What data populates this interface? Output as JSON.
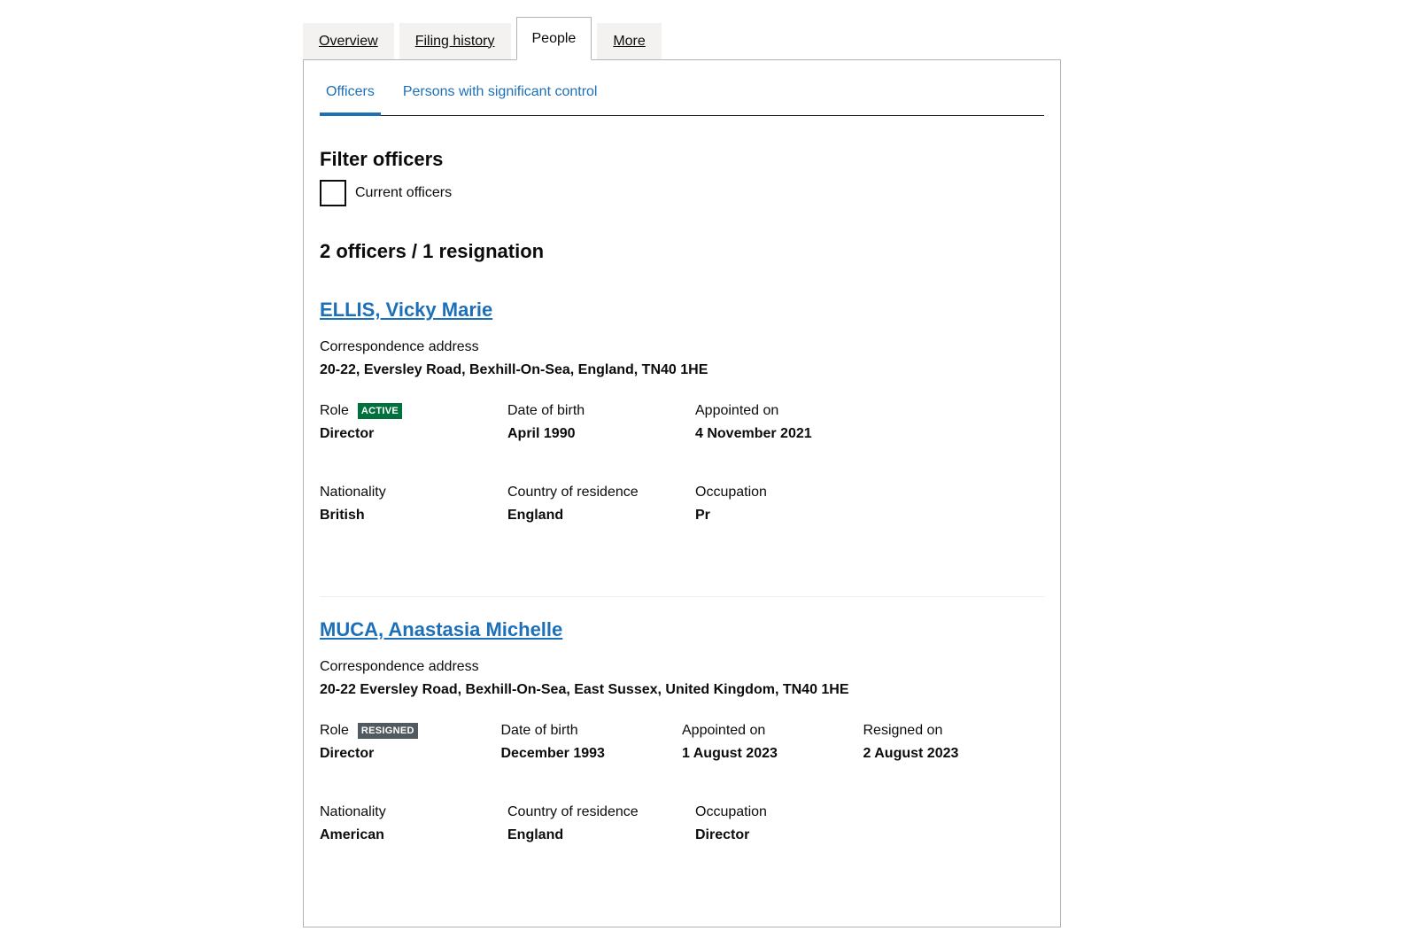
{
  "tabs": [
    {
      "label": "Overview",
      "active": false
    },
    {
      "label": "Filing history",
      "active": false
    },
    {
      "label": "People",
      "active": true
    },
    {
      "label": "More",
      "active": false
    }
  ],
  "subtabs": [
    {
      "label": "Officers",
      "active": true
    },
    {
      "label": "Persons with significant control",
      "active": false
    }
  ],
  "filter": {
    "title": "Filter officers",
    "checkbox_label": "Current officers",
    "checked": false
  },
  "summary": "2 officers / 1 resignation",
  "labels": {
    "address": "Correspondence address",
    "role": "Role",
    "dob": "Date of birth",
    "appointed": "Appointed on",
    "resigned": "Resigned on",
    "nationality": "Nationality",
    "country": "Country of residence",
    "occupation": "Occupation"
  },
  "officers": [
    {
      "name": "ELLIS, Vicky Marie",
      "address": "20-22, Eversley Road, Bexhill-On-Sea, England, TN40 1HE",
      "status": "ACTIVE",
      "status_color": "#00703c",
      "role": "Director",
      "dob": "April 1990",
      "appointed": "4 November 2021",
      "nationality": "British",
      "country": "England",
      "occupation": "Pr"
    },
    {
      "name": "MUCA, Anastasia Michelle",
      "address": "20-22 Eversley Road, Bexhill-On-Sea, East Sussex, United Kingdom, TN40 1HE",
      "status": "RESIGNED",
      "status_color": "#505a5f",
      "role": "Director",
      "dob": "December 1993",
      "appointed": "1 August 2023",
      "resigned": "2 August 2023",
      "nationality": "American",
      "country": "England",
      "occupation": "Director"
    }
  ]
}
